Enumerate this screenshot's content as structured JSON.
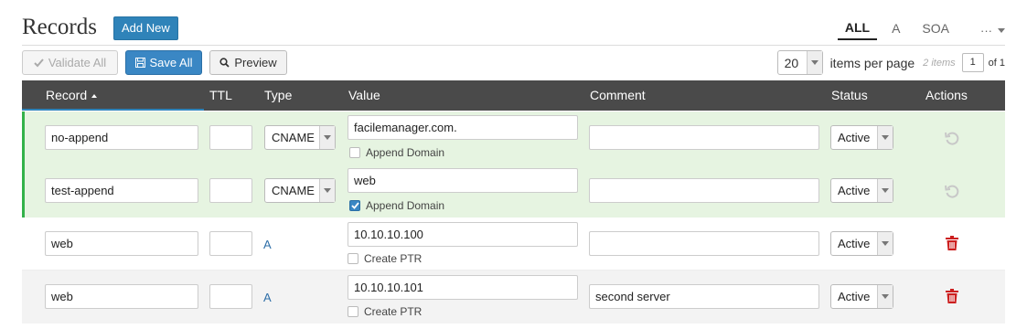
{
  "header": {
    "title": "Records",
    "add_new_label": "Add New",
    "tabs": [
      {
        "label": "ALL",
        "active": true
      },
      {
        "label": "A",
        "active": false
      },
      {
        "label": "SOA",
        "active": false
      }
    ],
    "more_label": "···"
  },
  "toolbar": {
    "validate_label": "Validate All",
    "save_label": "Save All",
    "preview_label": "Preview"
  },
  "pager": {
    "per_page_value": "20",
    "per_page_label": "items per page",
    "count": "2 items",
    "page": "1",
    "of_label": "of 1"
  },
  "columns": {
    "record": "Record",
    "ttl": "TTL",
    "type": "Type",
    "value": "Value",
    "comment": "Comment",
    "status": "Status",
    "actions": "Actions"
  },
  "rows": [
    {
      "record": "no-append",
      "ttl": "",
      "type": "CNAME",
      "value": "facilemanager.com.",
      "checkbox_label": "Append Domain",
      "checked": false,
      "comment": "",
      "status": "Active",
      "action": "revert-icon"
    },
    {
      "record": "test-append",
      "ttl": "",
      "type": "CNAME",
      "value": "web",
      "checkbox_label": "Append Domain",
      "checked": true,
      "comment": "",
      "status": "Active",
      "action": "revert-icon"
    },
    {
      "record": "web",
      "ttl": "",
      "type": "A",
      "value": "10.10.10.100",
      "checkbox_label": "Create PTR",
      "checked": false,
      "comment": "",
      "status": "Active",
      "action": "trash-icon"
    },
    {
      "record": "web",
      "ttl": "",
      "type": "A",
      "value": "10.10.10.101",
      "checkbox_label": "Create PTR",
      "checked": false,
      "comment": "second server",
      "status": "Active",
      "action": "trash-icon"
    }
  ],
  "colors": {
    "accent": "#2f83b9",
    "new_row_bg": "#e6f4e1",
    "new_row_border": "#33b14a",
    "header_bg": "#4a4a4a",
    "delete": "#cc1f1f"
  }
}
